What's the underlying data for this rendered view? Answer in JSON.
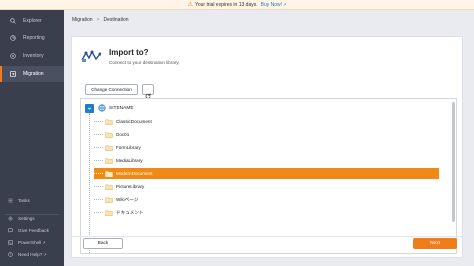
{
  "banner": {
    "message": "Your trial expires in 13 days.",
    "buy_label": "Buy Now!",
    "external_glyph": "↗"
  },
  "sidebar": {
    "items": [
      {
        "label": "Explorer",
        "icon": "search-icon"
      },
      {
        "label": "Reporting",
        "icon": "reporting-icon"
      },
      {
        "label": "Inventory",
        "icon": "inventory-icon"
      },
      {
        "label": "Migration",
        "icon": "migration-icon",
        "active": true
      }
    ],
    "bottom": [
      {
        "label": "Tasks",
        "icon": "tasks-icon"
      },
      {
        "label": "Settings",
        "icon": "gear-icon"
      },
      {
        "label": "Give Feedback",
        "icon": "feedback-icon"
      },
      {
        "label": "PowerShell",
        "icon": "powershell-icon",
        "external_glyph": "↗"
      },
      {
        "label": "Need Help?",
        "icon": "help-icon",
        "external_glyph": "↗"
      }
    ]
  },
  "breadcrumb": {
    "items": [
      "Migration",
      "Destination"
    ],
    "separator": ">"
  },
  "main": {
    "title": "Import to?",
    "subtitle": "Connect to your destination library.",
    "change_connection_label": "Change Connection",
    "refresh_icon": "refresh-icon",
    "tree": {
      "root": "SITENAME",
      "items": [
        {
          "label": "ClassicDocument"
        },
        {
          "label": "Doc01"
        },
        {
          "label": "FormLibrary"
        },
        {
          "label": "MediaLibrary"
        },
        {
          "label": "ModernDocument",
          "selected": true
        },
        {
          "label": "PictureLibrary"
        },
        {
          "label": "Wikiページ"
        },
        {
          "label": "ドキュメント"
        }
      ]
    },
    "back_label": "Back",
    "next_label": "Next"
  },
  "colors": {
    "accent": "#f07d1c",
    "sidebar_bg": "#3a3f4e",
    "link": "#1e7fc4",
    "selected_row": "#f08a14"
  }
}
